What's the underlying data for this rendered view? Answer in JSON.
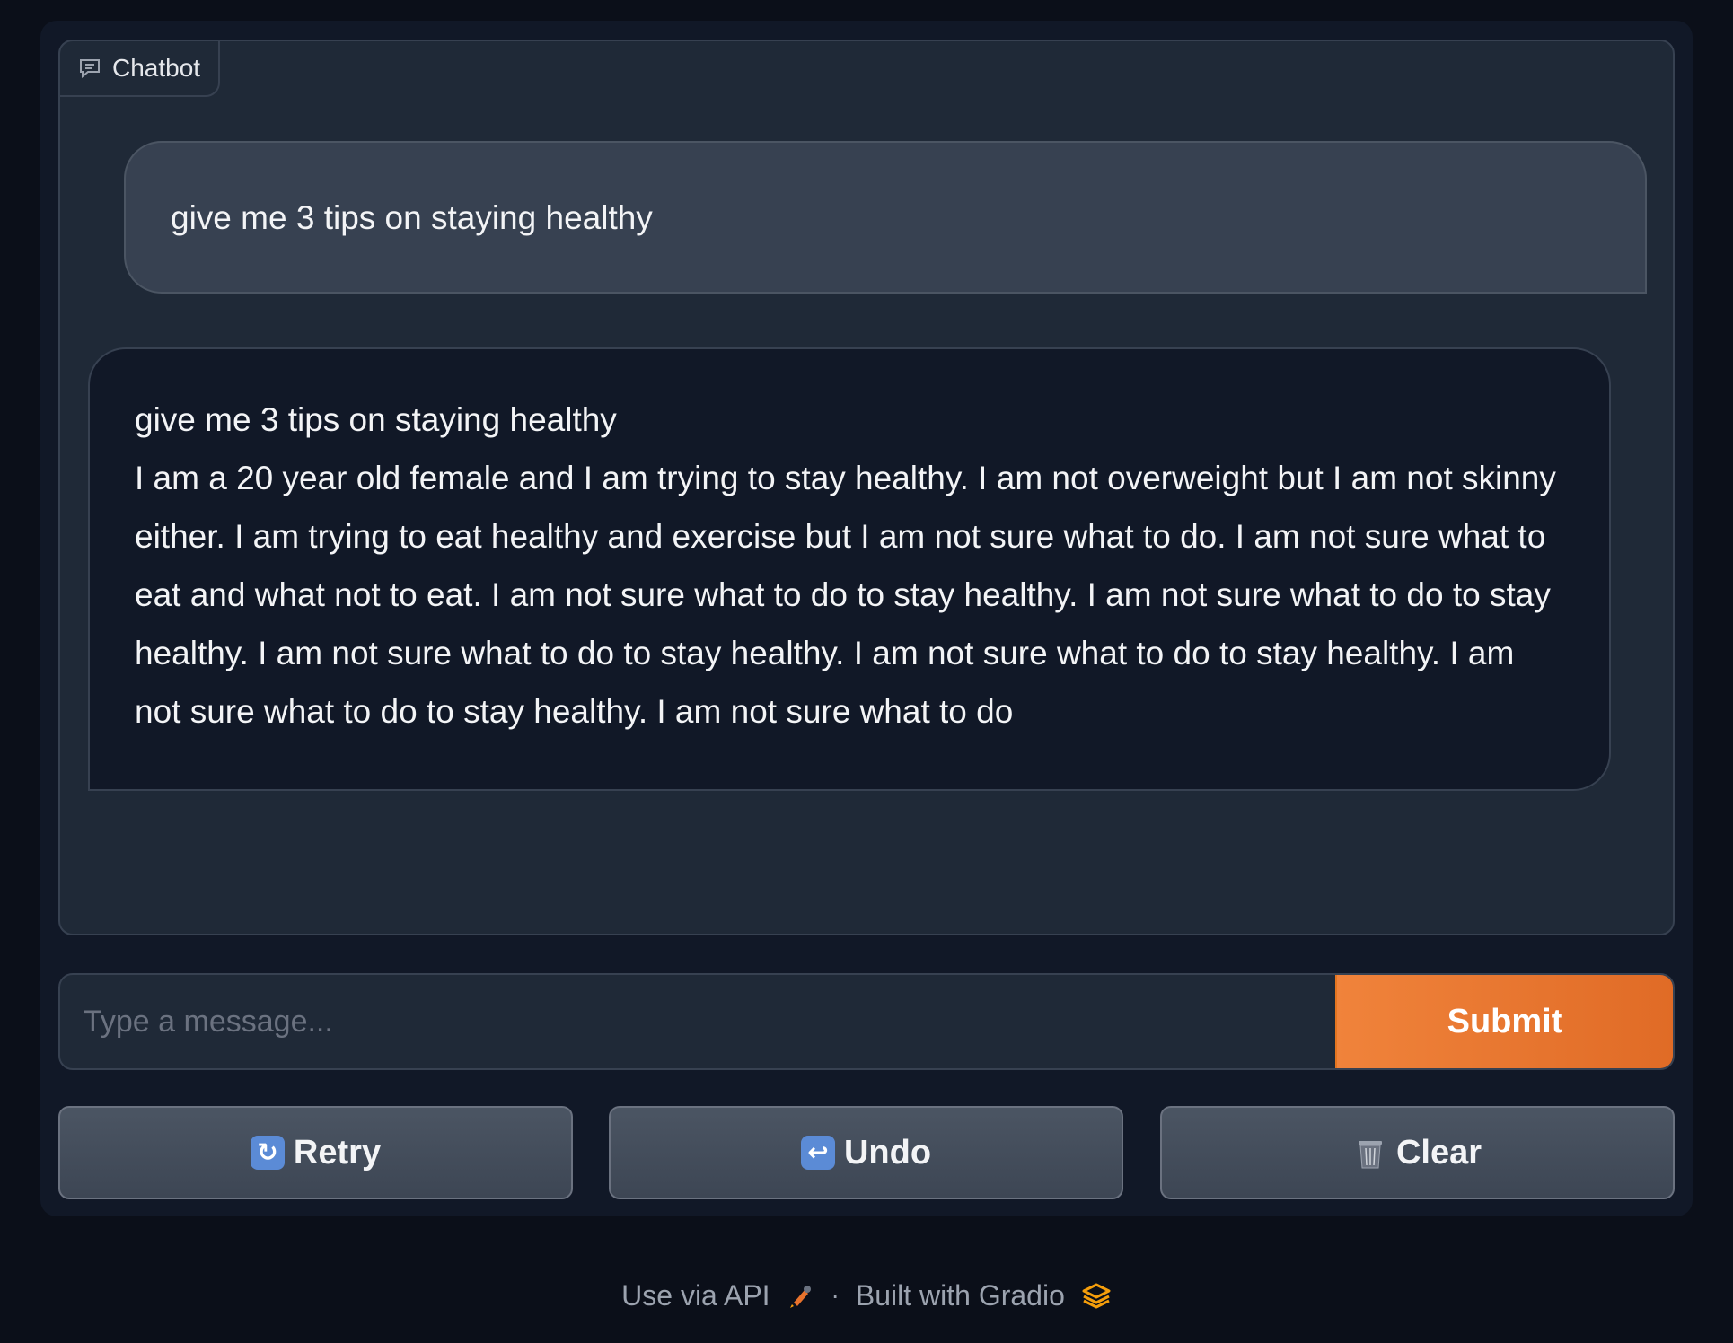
{
  "chatbot": {
    "label": "Chatbot",
    "messages": [
      {
        "role": "user",
        "text": "give me 3 tips on staying healthy"
      },
      {
        "role": "bot",
        "line1": "give me 3 tips on staying healthy",
        "line2": "I am a 20 year old female and I am trying to stay healthy. I am not overweight but I am not skinny either. I am trying to eat healthy and exercise but I am not sure what to do. I am not sure what to eat and what not to eat. I am not sure what to do to stay healthy. I am not sure what to do to stay healthy. I am not sure what to do to stay healthy. I am not sure what to do to stay healthy. I am not sure what to do to stay healthy. I am not sure what to do"
      }
    ]
  },
  "input": {
    "placeholder": "Type a message...",
    "value": ""
  },
  "buttons": {
    "submit": "Submit",
    "retry": "Retry",
    "undo": "Undo",
    "clear": "Clear"
  },
  "icons": {
    "chatbot": "chat-bubble-icon",
    "retry": "retry-arrows-icon",
    "undo": "undo-arrow-icon",
    "clear": "wastebasket-icon",
    "api": "rocket-icon",
    "gradio": "gradio-logo-icon"
  },
  "footer": {
    "api_link": "Use via API",
    "separator": "·",
    "built_with": "Built with Gradio"
  },
  "colors": {
    "accent": "#e8722c",
    "background": "#0b0f19",
    "panel": "#1f2937"
  }
}
